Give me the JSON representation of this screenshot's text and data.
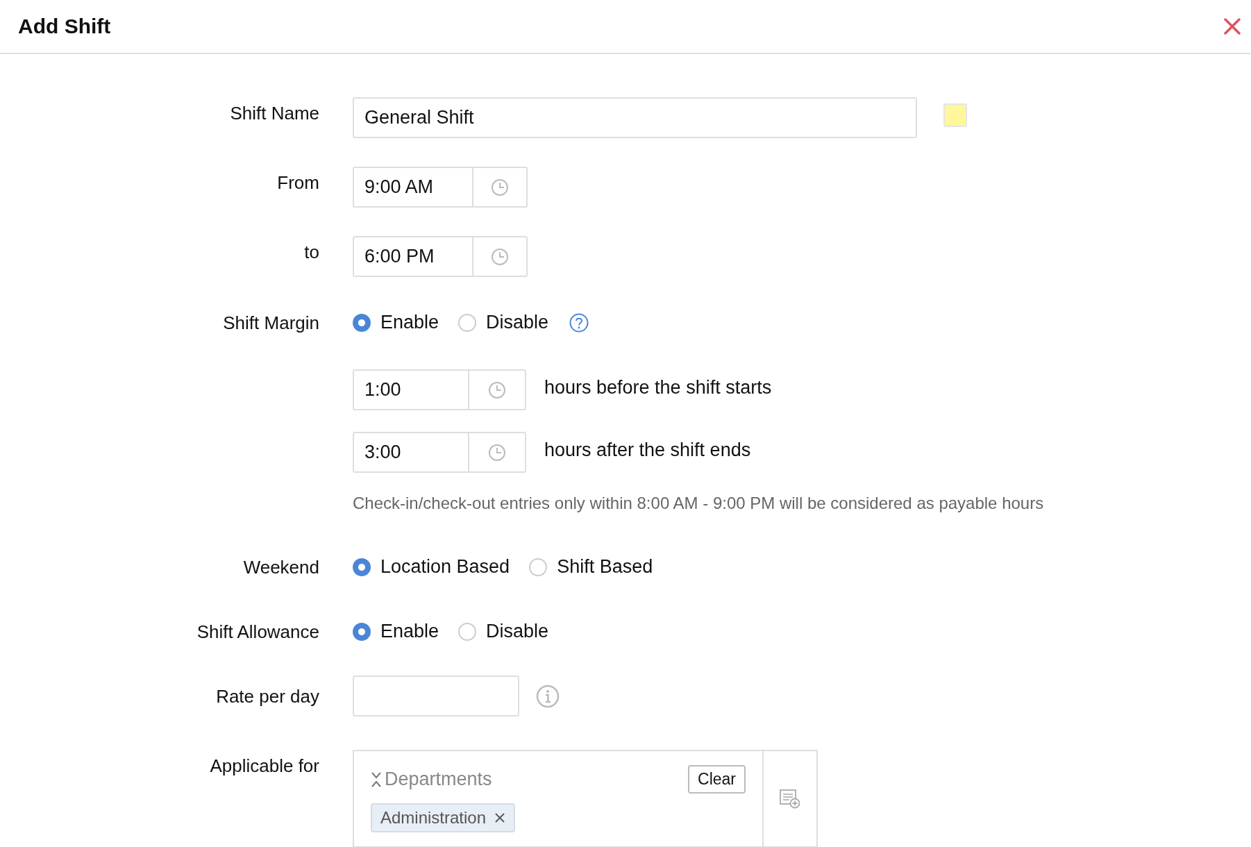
{
  "dialog": {
    "title": "Add Shift"
  },
  "shift_name": {
    "label": "Shift Name",
    "value": "General Shift",
    "color": "#fff799"
  },
  "from": {
    "label": "From",
    "value": "9:00 AM"
  },
  "to": {
    "label": "to",
    "value": "6:00 PM"
  },
  "shift_margin": {
    "label": "Shift Margin",
    "options": [
      {
        "label": "Enable",
        "selected": true
      },
      {
        "label": "Disable",
        "selected": false
      }
    ],
    "before": {
      "value": "1:00",
      "text": "hours before the shift starts"
    },
    "after": {
      "value": "3:00",
      "text": "hours after the shift ends"
    },
    "note": "Check-in/check-out entries only within 8:00 AM - 9:00 PM will be considered as payable hours"
  },
  "weekend": {
    "label": "Weekend",
    "options": [
      {
        "label": "Location Based",
        "selected": true
      },
      {
        "label": "Shift Based",
        "selected": false
      }
    ]
  },
  "shift_allowance": {
    "label": "Shift Allowance",
    "options": [
      {
        "label": "Enable",
        "selected": true
      },
      {
        "label": "Disable",
        "selected": false
      }
    ]
  },
  "rate_per_day": {
    "label": "Rate per day"
  },
  "applicable_for": {
    "label": "Applicable for",
    "group": "Departments",
    "clear": "Clear",
    "tags": [
      "Administration"
    ]
  }
}
